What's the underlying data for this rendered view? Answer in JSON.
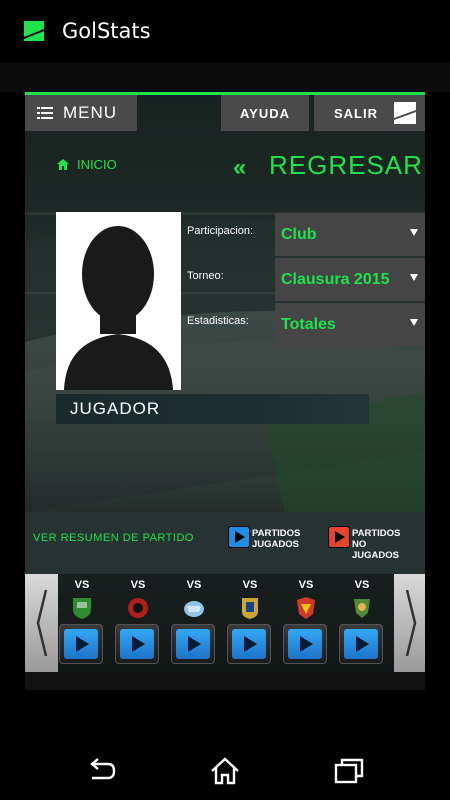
{
  "app": {
    "title": "GolStats"
  },
  "topbar": {
    "menu_label": "MENU",
    "help_label": "AYUDA",
    "exit_label": "SALIR"
  },
  "nav": {
    "home_label": "INICIO",
    "back_arrows": "«",
    "back_label": "REGRESAR"
  },
  "player": {
    "name_label": "JUGADOR"
  },
  "filters": [
    {
      "label": "Participacion:",
      "value": "Club"
    },
    {
      "label": "Torneo:",
      "value": "Clausura 2015"
    },
    {
      "label": "Estadisticas:",
      "value": "Totales"
    }
  ],
  "summary": {
    "title": "VER RESUMEN DE PARTIDO",
    "played": {
      "line1": "PARTIDOS",
      "line2": "JUGADOS"
    },
    "not_played": {
      "line1": "PARTIDOS",
      "line2": "NO",
      "line3": "JUGADOS"
    }
  },
  "matches": [
    {
      "vs": "VS",
      "crest_color": "#2e8b2e"
    },
    {
      "vs": "VS",
      "crest_color": "#b01e1e"
    },
    {
      "vs": "VS",
      "crest_color": "#8fc3e8"
    },
    {
      "vs": "VS",
      "crest_color": "#c9a531"
    },
    {
      "vs": "VS",
      "crest_color": "#d0392b"
    },
    {
      "vs": "VS",
      "crest_color": "#4d8a3a"
    }
  ],
  "colors": {
    "accent": "#1ee34a",
    "played": "#1f8ee8",
    "not_played": "#e5432c"
  }
}
